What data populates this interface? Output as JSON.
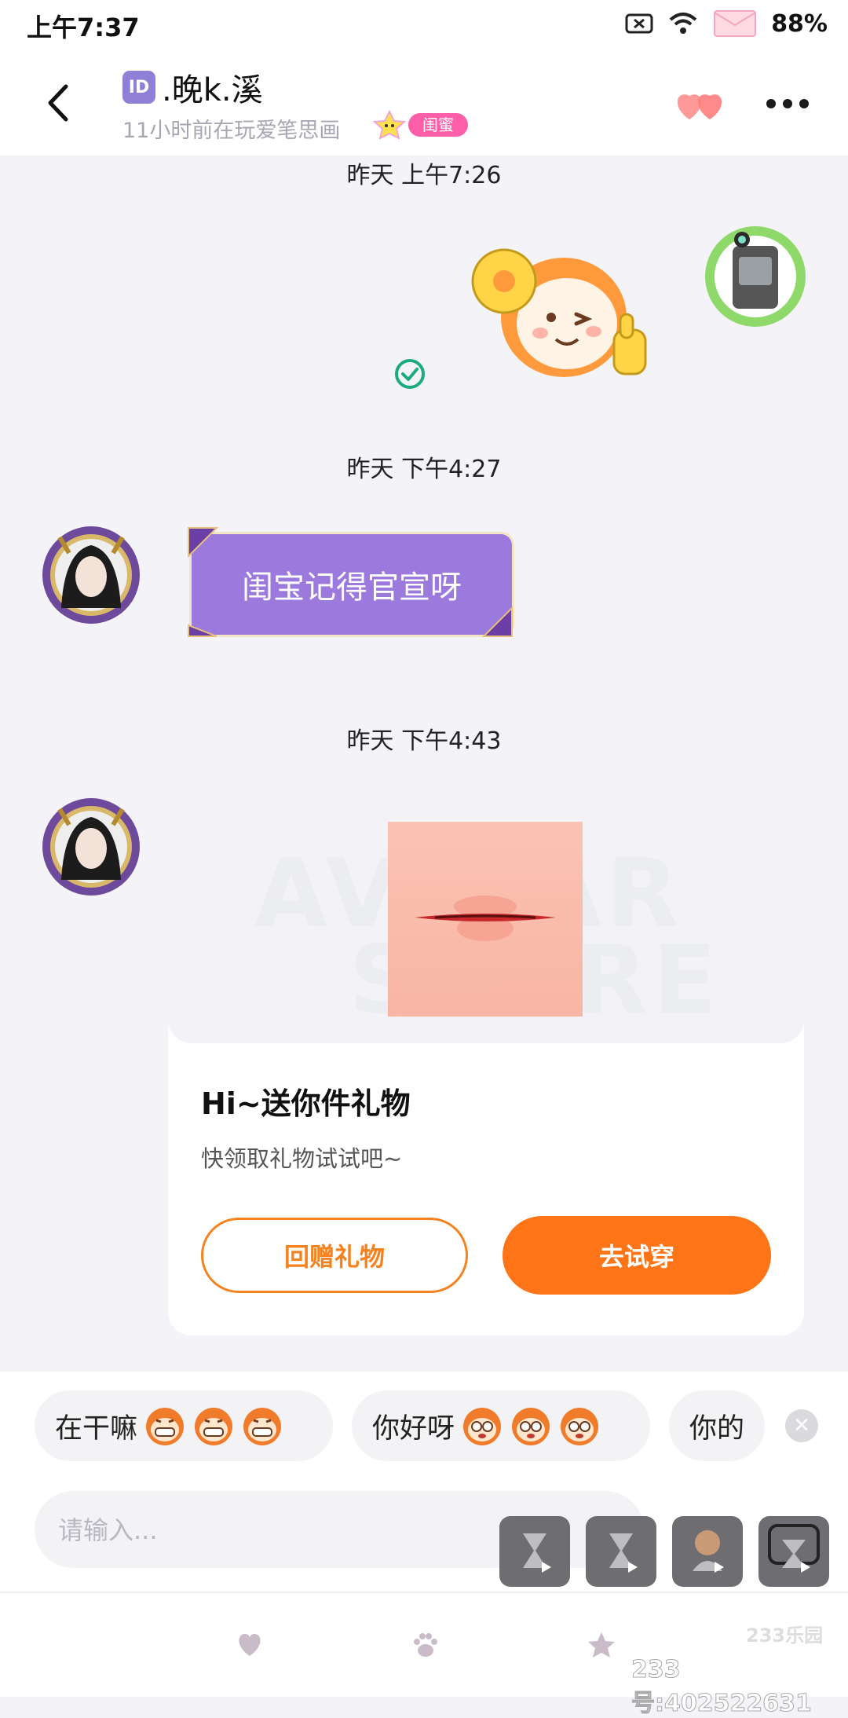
{
  "status_bar": {
    "time": "上午7:37",
    "battery": "88%"
  },
  "header": {
    "id_badge": "ID",
    "nickname": ".晚k.溪",
    "subtitle": "11小时前在玩爱笔思画",
    "relation_tag": "闺蜜"
  },
  "messages": {
    "ts1": "昨天 上午7:26",
    "ts2": "昨天 下午4:27",
    "bubble_text": "闺宝记得官宣呀",
    "ts3": "昨天 下午4:43"
  },
  "gift_card": {
    "watermark_line1": "AVATAR",
    "watermark_line2": "STORE",
    "title": "Hi~送你件礼物",
    "subtitle": "快领取礼物试试吧~",
    "return_button": "回赠礼物",
    "try_button": "去试穿"
  },
  "quick_replies": [
    {
      "text": "在干嘛"
    },
    {
      "text": "你好呀"
    },
    {
      "text": "你的"
    }
  ],
  "input": {
    "placeholder": "请输入..."
  },
  "bottom_nav": [
    {
      "icon": "heart-icon"
    },
    {
      "icon": "paw-icon"
    },
    {
      "icon": "star-icon"
    }
  ],
  "watermarks": {
    "corner": "233乐园",
    "footer_id": "233号:402522631"
  },
  "colors": {
    "accent_orange": "#ff7416",
    "bubble_purple": "#9c79dc",
    "tag_pink": "#ff5ea8"
  }
}
